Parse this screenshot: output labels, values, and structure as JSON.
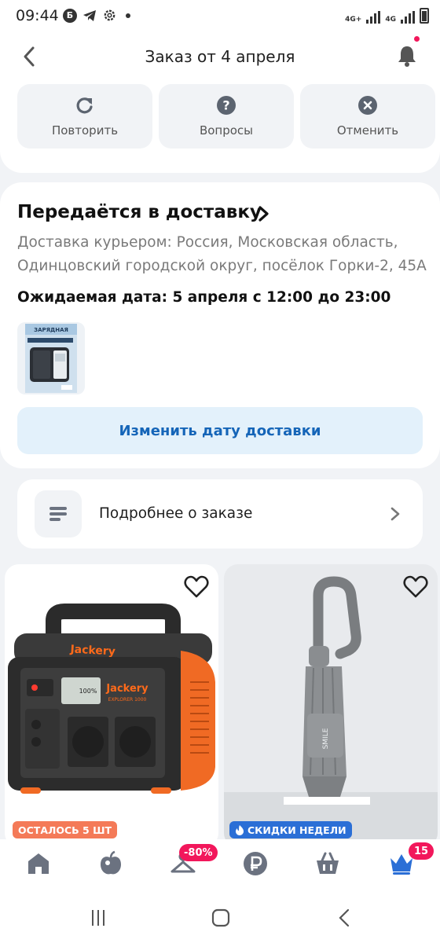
{
  "status_bar": {
    "time": "09:44",
    "icons": [
      "b-circle-icon",
      "telegram-icon",
      "settings-icon",
      "dot-icon"
    ],
    "network_1": "4G+",
    "network_2": "4G"
  },
  "header": {
    "title": "Заказ от 4 апреля",
    "actions": [
      {
        "label": "Повторить",
        "icon": "refresh-icon"
      },
      {
        "label": "Вопросы",
        "icon": "question-icon"
      },
      {
        "label": "Отменить",
        "icon": "close-icon"
      }
    ]
  },
  "delivery": {
    "status": "Передаётся в доставку",
    "address": "Доставка курьером: Россия, Московская область, Одинцовский городской округ, посёлок Горки-2, 45А",
    "expected_date": "Ожидаемая дата: 5 апреля с 12:00 до 23:00",
    "thumbnail_caption": "ЗАРЯДНАЯ",
    "change_button": "Изменить дату доставки"
  },
  "order_details": {
    "label": "Подробнее о заказе"
  },
  "products": [
    {
      "brand": "Jackery",
      "model": "EXPLORER 1000",
      "display": "100%",
      "badge": "ОСТАЛОСЬ 5 ШТ",
      "badge_color": "#f47a58"
    },
    {
      "brand": "SMILE",
      "badge": "СКИДКИ НЕДЕЛИ",
      "badge_color": "#2b6fd6"
    }
  ],
  "bottom_nav": {
    "items": [
      "home-icon",
      "apple-icon",
      "hanger-icon",
      "ruble-icon",
      "basket-icon",
      "crown-icon"
    ],
    "promo_badge": "-80%",
    "profile_badge": "15",
    "accent": "#2b6fd6"
  },
  "colors": {
    "link_blue": "#1565b8",
    "notification_pink": "#f2175b"
  }
}
